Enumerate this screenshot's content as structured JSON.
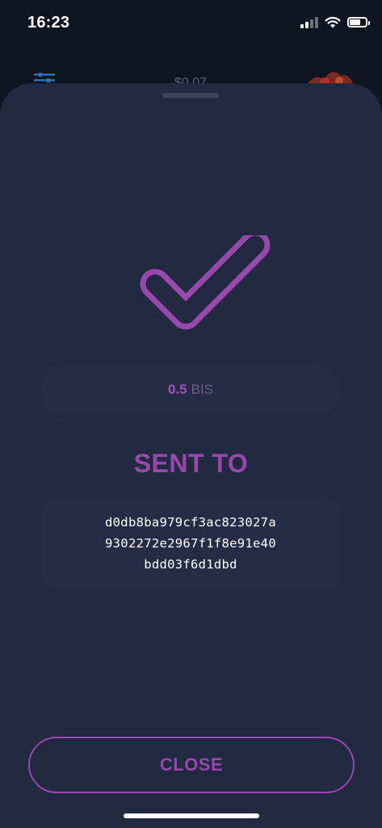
{
  "status_bar": {
    "time": "16:23",
    "battery_level": 0.75
  },
  "background_app": {
    "balance": "$0.07"
  },
  "sheet": {
    "amount": {
      "value": "0.5",
      "unit": "BIS"
    },
    "sent_to_title": "SENT TO",
    "address_lines": [
      "d0db8ba979cf3ac823027a",
      "9302272e2967f1f8e91e40",
      "bdd03f6d1dbd"
    ],
    "close_label": "CLOSE"
  },
  "colors": {
    "accent": "#9a47ad",
    "sheet_background": "#222a41",
    "pill_background": "#262c45",
    "screen_background": "#101522"
  }
}
